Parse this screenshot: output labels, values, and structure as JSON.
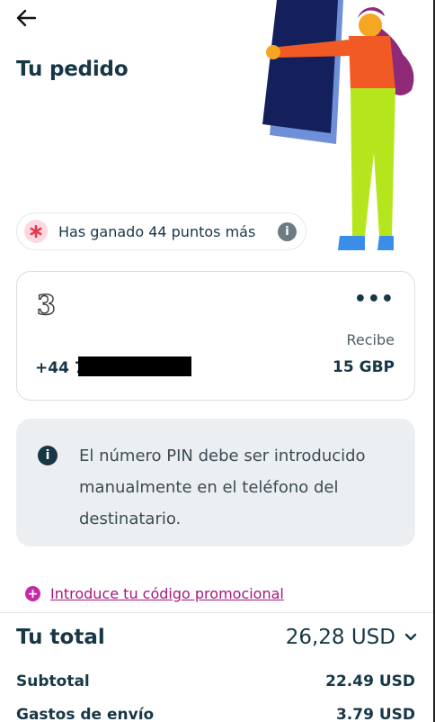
{
  "header": {
    "title": "Tu pedido"
  },
  "points": {
    "text": "Has ganado 44 puntos más"
  },
  "card": {
    "operator_logo": "3",
    "receive_label": "Recibe",
    "phone_prefix": "+44 7",
    "amount": "15 GBP"
  },
  "notice": {
    "message": "El número PIN debe ser introducido manualmente en el teléfono del destinatario."
  },
  "promo": {
    "label": "Introduce tu código promocional"
  },
  "summary": {
    "total_label": "Tu total",
    "total_value": "26,28 USD",
    "rows": [
      {
        "label": "Subtotal",
        "value": "22.49 USD"
      },
      {
        "label": "Gastos de envío",
        "value": "3.79 USD"
      }
    ]
  },
  "colors": {
    "accent": "#c42aa8",
    "text": "#173746",
    "notice_bg": "#eceff2"
  }
}
